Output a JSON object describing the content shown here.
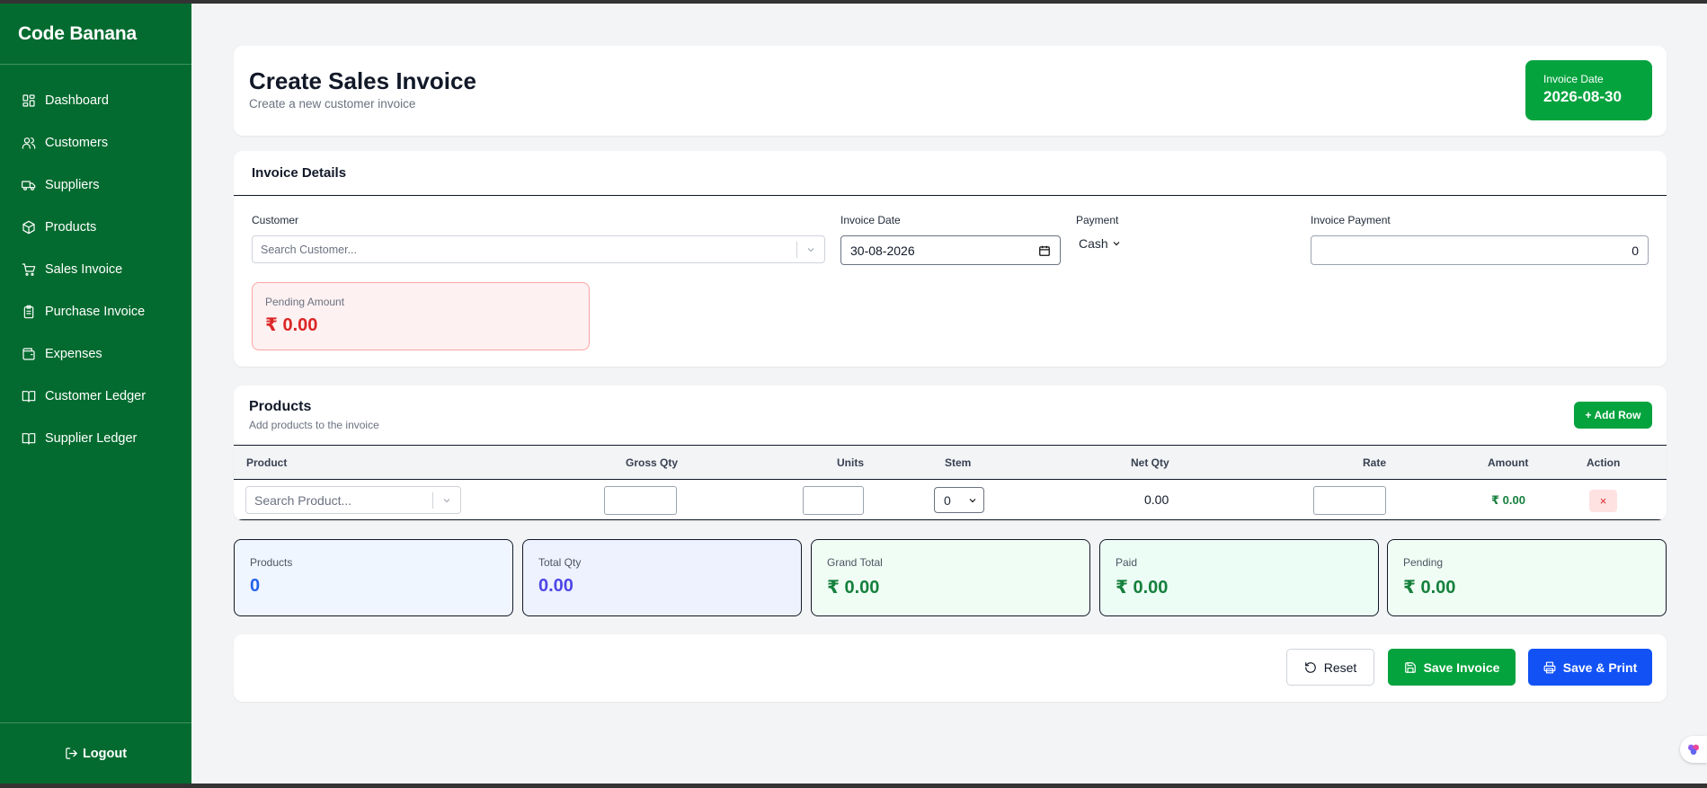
{
  "sidebar": {
    "brand": "Code Banana",
    "items": [
      {
        "label": "Dashboard",
        "icon": "dashboard-icon"
      },
      {
        "label": "Customers",
        "icon": "users-icon"
      },
      {
        "label": "Suppliers",
        "icon": "truck-icon"
      },
      {
        "label": "Products",
        "icon": "package-icon"
      },
      {
        "label": "Sales Invoice",
        "icon": "cart-icon"
      },
      {
        "label": "Purchase Invoice",
        "icon": "clipboard-icon"
      },
      {
        "label": "Expenses",
        "icon": "wallet-icon"
      },
      {
        "label": "Customer Ledger",
        "icon": "book-icon"
      },
      {
        "label": "Supplier Ledger",
        "icon": "book-icon"
      }
    ],
    "logout": "Logout"
  },
  "header": {
    "title": "Create Sales Invoice",
    "subtitle": "Create a new customer invoice",
    "date_label": "Invoice Date",
    "date_value": "2026-08-30"
  },
  "details": {
    "title": "Invoice Details",
    "customer_label": "Customer",
    "customer_placeholder": "Search Customer...",
    "invoice_date_label": "Invoice Date",
    "invoice_date_value": "30-08-2026",
    "payment_label": "Payment",
    "payment_value": "Cash",
    "invoice_payment_label": "Invoice Payment",
    "invoice_payment_value": "0",
    "pending_label": "Pending Amount",
    "pending_value": "₹ 0.00"
  },
  "products": {
    "title": "Products",
    "subtitle": "Add products to the invoice",
    "add_row": "+ Add Row",
    "columns": [
      "Product",
      "Gross Qty",
      "Units",
      "Stem",
      "Net Qty",
      "Rate",
      "Amount",
      "Action"
    ],
    "row": {
      "product_placeholder": "Search Product...",
      "stem_value": "0",
      "net_qty": "0.00",
      "amount": "₹ 0.00",
      "delete": "×"
    }
  },
  "stats": [
    {
      "label": "Products",
      "value": "0",
      "color": "#2563eb",
      "bg": "#eff6ff"
    },
    {
      "label": "Total Qty",
      "value": "0.00",
      "color": "#4f46e5",
      "bg": "#eef2ff"
    },
    {
      "label": "Grand Total",
      "value": "₹ 0.00",
      "color": "#15803d",
      "bg": "#f0fdf4"
    },
    {
      "label": "Paid",
      "value": "₹ 0.00",
      "color": "#15803d",
      "bg": "#ecfdf5"
    },
    {
      "label": "Pending",
      "value": "₹ 0.00",
      "color": "#15803d",
      "bg": "#f0fdf4"
    }
  ],
  "actions": {
    "reset": "Reset",
    "save": "Save Invoice",
    "save_print": "Save & Print"
  },
  "colors": {
    "sidebar": "#036b2f",
    "primary_green": "#05a33e",
    "primary_blue": "#1252f5",
    "danger": "#dc2626"
  }
}
